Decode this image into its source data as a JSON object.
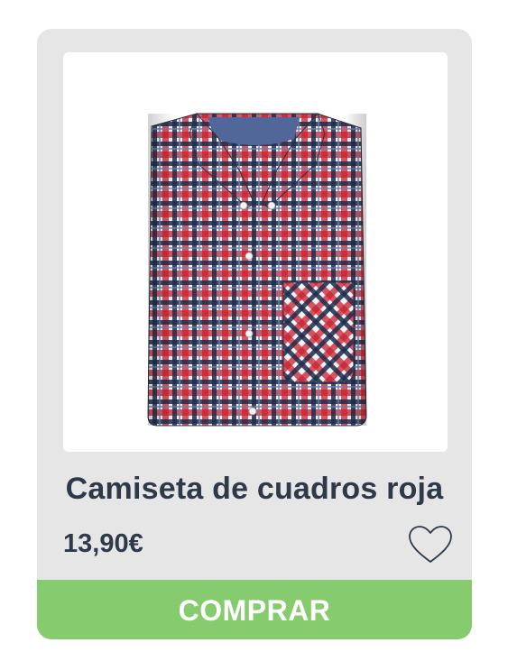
{
  "product": {
    "title": "Camiseta de cuadros roja",
    "price": "13,90€",
    "image_alt": "Camiseta de cuadros roja",
    "favorite_icon": "heart-outline-icon"
  },
  "actions": {
    "buy_label": "COMPRAR"
  },
  "colors": {
    "card_background": "#e6e6e6",
    "text": "#2e3a4a",
    "buy_button": "#86cc6f",
    "heart_stroke": "#2e3a4a",
    "plaid_red": "#c8202e",
    "plaid_navy": "#1f2c4d",
    "plaid_blue": "#6f7fa8",
    "plaid_white": "#f4f4f6"
  }
}
